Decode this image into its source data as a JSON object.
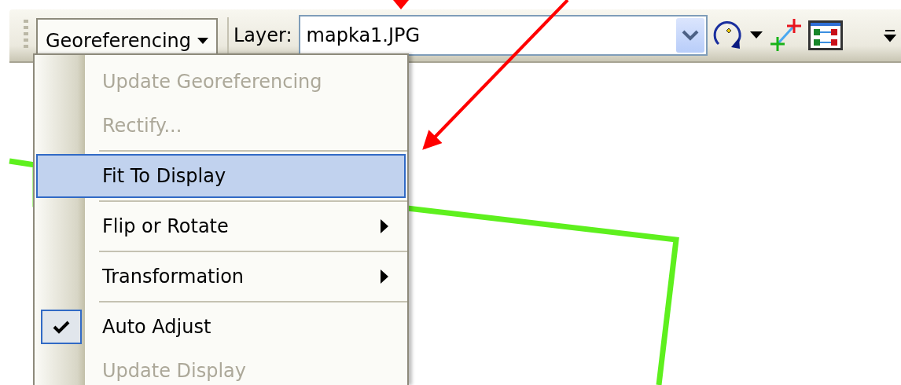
{
  "toolbar": {
    "menu_label": "Georeferencing",
    "layer_label": "Layer:",
    "layer_value": "mapka1.JPG"
  },
  "menu": {
    "items": [
      {
        "label": "Update Georeferencing",
        "kind": "command",
        "disabled": true,
        "selected": false,
        "checked": false,
        "separator_before": false
      },
      {
        "label": "Rectify...",
        "kind": "command",
        "disabled": true,
        "selected": false,
        "checked": false,
        "separator_before": false
      },
      {
        "label": "Fit To Display",
        "kind": "command",
        "disabled": false,
        "selected": true,
        "checked": false,
        "separator_before": true
      },
      {
        "label": "Flip or Rotate",
        "kind": "submenu",
        "disabled": false,
        "selected": false,
        "checked": false,
        "separator_before": true
      },
      {
        "label": "Transformation",
        "kind": "submenu",
        "disabled": false,
        "selected": false,
        "checked": false,
        "separator_before": true
      },
      {
        "label": "Auto Adjust",
        "kind": "command",
        "disabled": false,
        "selected": false,
        "checked": true,
        "separator_before": true
      },
      {
        "label": "Update Display",
        "kind": "command",
        "disabled": true,
        "selected": false,
        "checked": false,
        "separator_before": false
      }
    ]
  }
}
